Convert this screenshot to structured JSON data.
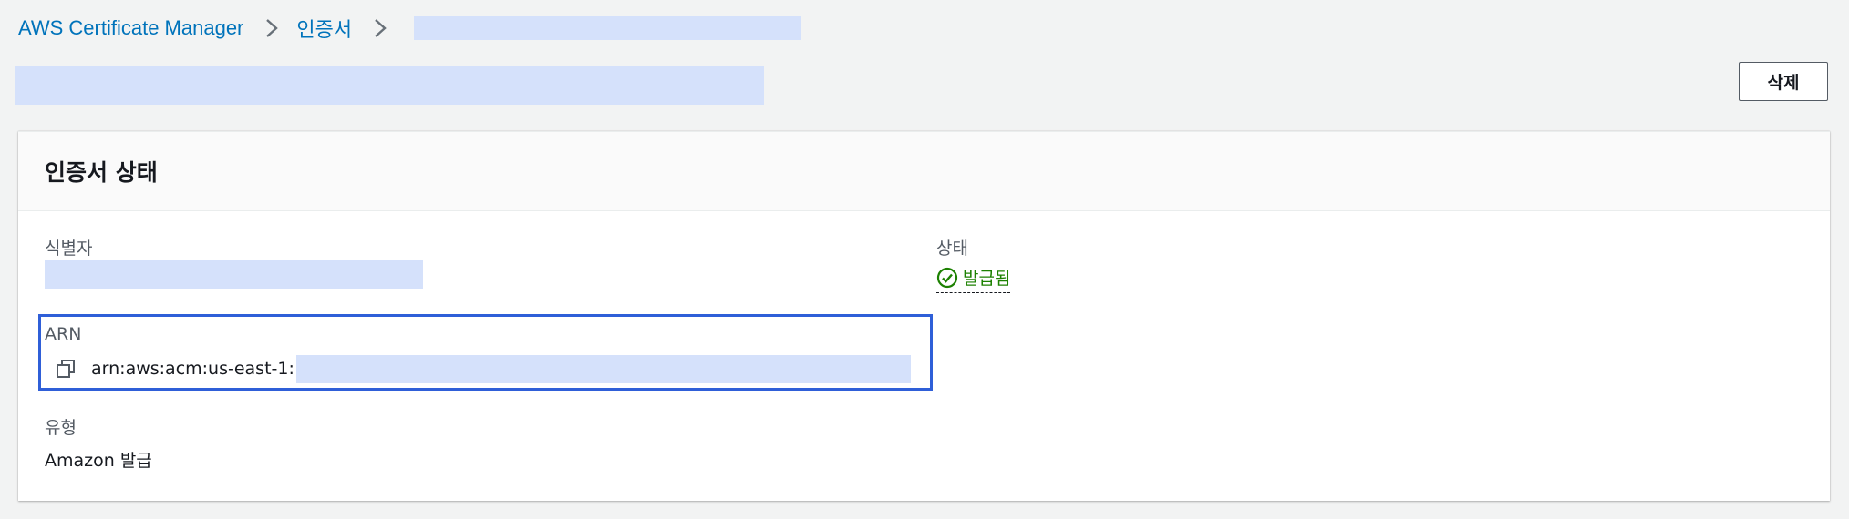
{
  "breadcrumb": {
    "service": "AWS Certificate Manager",
    "section": "인증서"
  },
  "header": {
    "delete_label": "삭제"
  },
  "panel": {
    "title": "인증서 상태",
    "identifier_label": "식별자",
    "arn_label": "ARN",
    "arn_prefix": "arn:aws:acm:us-east-1:",
    "type_label": "유형",
    "type_value": "Amazon 발급",
    "status_label": "상태",
    "status_value": "발급됨"
  },
  "icons": {
    "breadcrumb_separator": "chevron-right-icon",
    "copy": "copy-icon",
    "status": "check-circle-icon"
  },
  "colors": {
    "link": "#0073bb",
    "success": "#1d8102",
    "highlight_border": "#2f5fd8",
    "redaction": "#d5e1fb"
  }
}
